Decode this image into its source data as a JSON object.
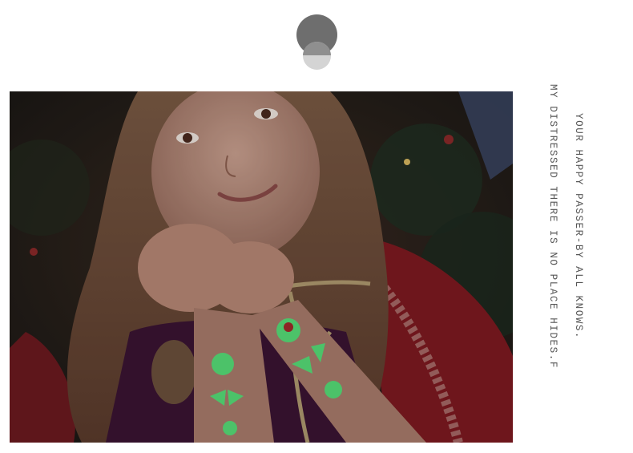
{
  "photo": {
    "subject": "girl with glowing tattoo stickers on arms"
  },
  "caption": {
    "line1": "YOUR HAPPY PASSER-BY ALL KNOWS.",
    "line2": "MY DISTRESSED THERE IS NO PLACE HIDES.F"
  },
  "colors": {
    "glow_green": "#4fe87a",
    "cape_red": "#8f1b22",
    "dress_purple": "#3b1433"
  }
}
